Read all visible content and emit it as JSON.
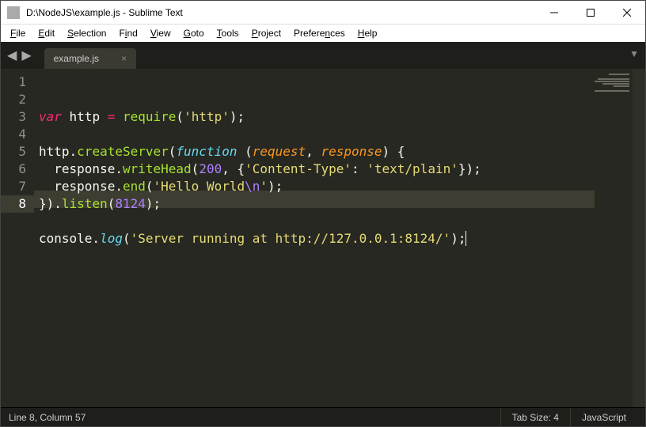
{
  "window": {
    "title": "D:\\NodeJS\\example.js - Sublime Text"
  },
  "menu": [
    {
      "u": "F",
      "rest": "ile"
    },
    {
      "u": "E",
      "rest": "dit"
    },
    {
      "u": "S",
      "rest": "election"
    },
    {
      "u": "",
      "rest": "F",
      "u2": "i",
      "rest2": "nd"
    },
    {
      "u": "V",
      "rest": "iew"
    },
    {
      "u": "G",
      "rest": "oto"
    },
    {
      "u": "T",
      "rest": "ools"
    },
    {
      "u": "P",
      "rest": "roject"
    },
    {
      "u": "",
      "rest": "Prefere",
      "u2": "n",
      "rest2": "ces"
    },
    {
      "u": "H",
      "rest": "elp"
    }
  ],
  "tabs": {
    "active": {
      "label": "example.js"
    }
  },
  "code_lines": [
    [
      {
        "c": "kw",
        "t": "var"
      },
      {
        "c": "pln",
        "t": " http "
      },
      {
        "c": "kw",
        "t": "="
      },
      {
        "c": "pln",
        "t": " "
      },
      {
        "c": "fn",
        "t": "require"
      },
      {
        "c": "pln",
        "t": "("
      },
      {
        "c": "str",
        "t": "'http'"
      },
      {
        "c": "pln",
        "t": ");"
      }
    ],
    [],
    [
      {
        "c": "pln",
        "t": "http."
      },
      {
        "c": "fn",
        "t": "createServer"
      },
      {
        "c": "pln",
        "t": "("
      },
      {
        "c": "storage",
        "t": "function"
      },
      {
        "c": "pln",
        "t": " ("
      },
      {
        "c": "param",
        "t": "request"
      },
      {
        "c": "pln",
        "t": ", "
      },
      {
        "c": "param",
        "t": "response"
      },
      {
        "c": "pln",
        "t": ") {"
      }
    ],
    [
      {
        "c": "pln",
        "t": "  response."
      },
      {
        "c": "fn",
        "t": "writeHead"
      },
      {
        "c": "pln",
        "t": "("
      },
      {
        "c": "num",
        "t": "200"
      },
      {
        "c": "pln",
        "t": ", {"
      },
      {
        "c": "str",
        "t": "'Content-Type'"
      },
      {
        "c": "pln",
        "t": ": "
      },
      {
        "c": "str",
        "t": "'text/plain'"
      },
      {
        "c": "pln",
        "t": "});"
      }
    ],
    [
      {
        "c": "pln",
        "t": "  response."
      },
      {
        "c": "fn",
        "t": "end"
      },
      {
        "c": "pln",
        "t": "("
      },
      {
        "c": "str",
        "t": "'Hello World"
      },
      {
        "c": "esc",
        "t": "\\n"
      },
      {
        "c": "str",
        "t": "'"
      },
      {
        "c": "pln",
        "t": ");"
      }
    ],
    [
      {
        "c": "pln",
        "t": "})."
      },
      {
        "c": "fn",
        "t": "listen"
      },
      {
        "c": "pln",
        "t": "("
      },
      {
        "c": "num",
        "t": "8124"
      },
      {
        "c": "pln",
        "t": ");"
      }
    ],
    [],
    [
      {
        "c": "pln",
        "t": "console."
      },
      {
        "c": "storage2",
        "t": "log"
      },
      {
        "c": "pln",
        "t": "("
      },
      {
        "c": "str",
        "t": "'Server running at http://127.0.0.1:8124/'"
      },
      {
        "c": "pln",
        "t": ");"
      }
    ]
  ],
  "active_line": 8,
  "status": {
    "position": "Line 8, Column 57",
    "tab_size": "Tab Size: 4",
    "syntax": "JavaScript"
  }
}
